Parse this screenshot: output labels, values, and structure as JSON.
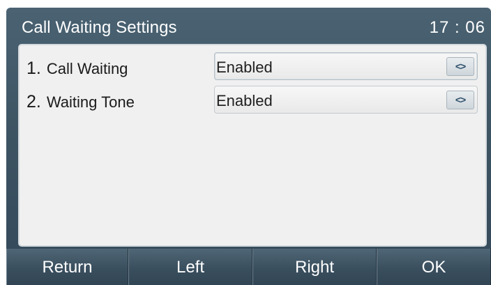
{
  "header": {
    "title": "Call Waiting Settings",
    "time": "17 : 06"
  },
  "settings": [
    {
      "number": "1.",
      "label": "Call Waiting",
      "value": "Enabled",
      "arrow_glyph": "<>"
    },
    {
      "number": "2.",
      "label": "Waiting Tone",
      "value": "Enabled",
      "arrow_glyph": "<>"
    }
  ],
  "softkeys": [
    "Return",
    "Left",
    "Right",
    "OK"
  ],
  "colors": {
    "title_bar_background": "#4a6272",
    "panel_background": "#f0f0f0",
    "softkey_background": "#3a4f5e",
    "arrow_color": "#2c4f6b"
  },
  "icons": {
    "selector_arrows": "left-right-arrows-icon"
  }
}
